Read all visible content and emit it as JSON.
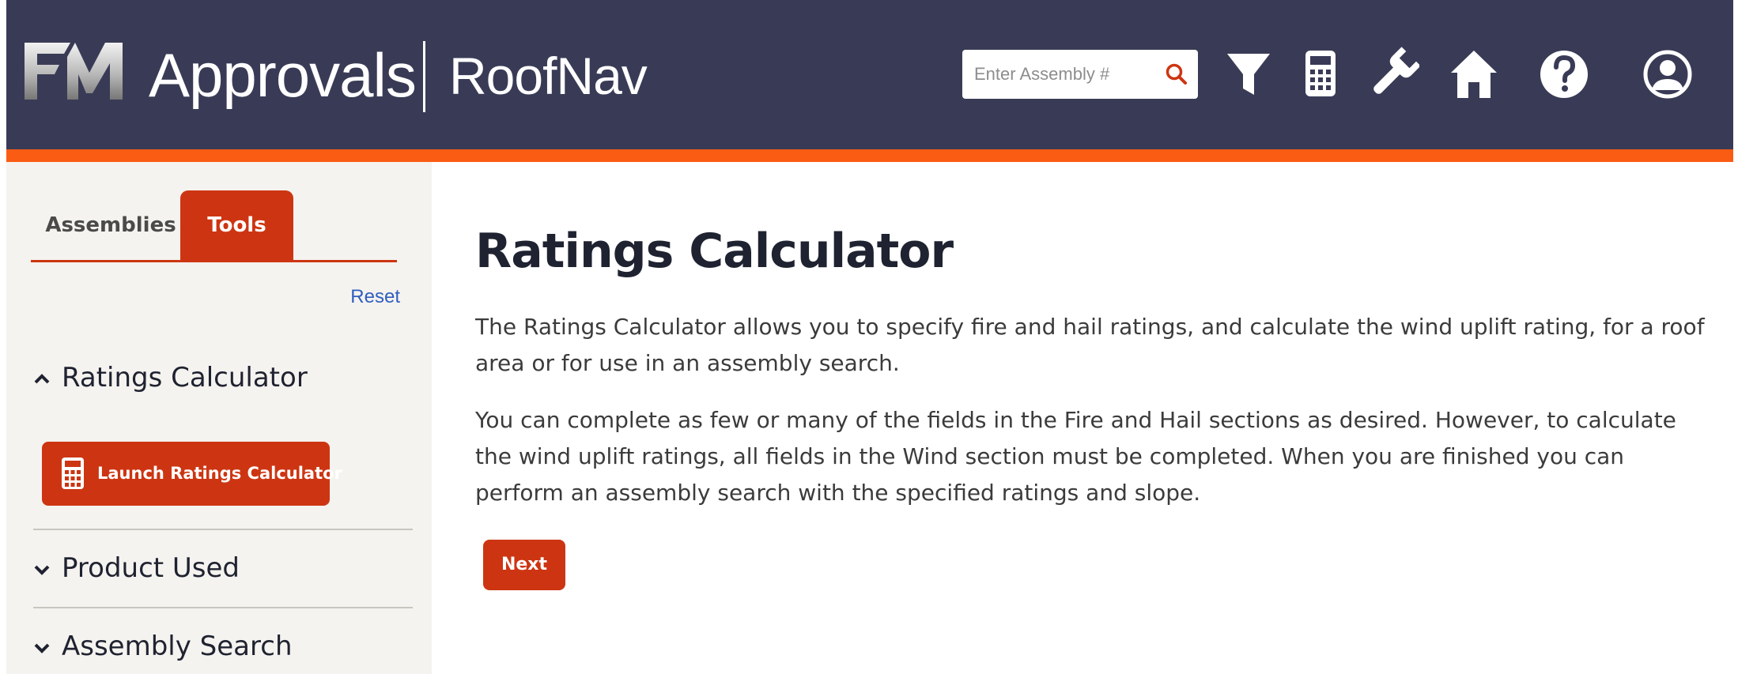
{
  "header": {
    "brand": "Approvals",
    "product": "RoofNav",
    "logo": "FM-logo",
    "search": {
      "placeholder": "Enter Assembly #",
      "value": ""
    },
    "icons": [
      "filter-icon",
      "calculator-icon",
      "wrench-icon",
      "home-icon",
      "help-icon",
      "user-profile-icon"
    ]
  },
  "sidebar": {
    "tabs": [
      {
        "label": "Assemblies",
        "active": false
      },
      {
        "label": "Tools",
        "active": true
      }
    ],
    "reset_label": "Reset",
    "sections": [
      {
        "label": "Ratings Calculator",
        "expanded": true
      },
      {
        "label": "Product Used",
        "expanded": false
      },
      {
        "label": "Assembly Search",
        "expanded": false
      }
    ],
    "launch_label": "Launch Ratings Calculator"
  },
  "main": {
    "title": "Ratings Calculator",
    "paragraphs": [
      "The Ratings Calculator allows you to specify fire and hail ratings, and calculate the wind uplift rating, for a roof area or for use in an assembly search.",
      "You can complete as few or many of the fields in the Fire and Hail sections as desired. However, to calculate the wind uplift ratings, all fields in the Wind section must be completed. When you are finished you can perform an assembly search with the specified ratings and slope."
    ],
    "next_label": "Next"
  },
  "colors": {
    "header_bg": "#393b56",
    "accent_stripe": "#fa5c14",
    "primary_button": "#cd3512",
    "sidebar_bg": "#f5f3ef",
    "link": "#2f5ebf"
  }
}
